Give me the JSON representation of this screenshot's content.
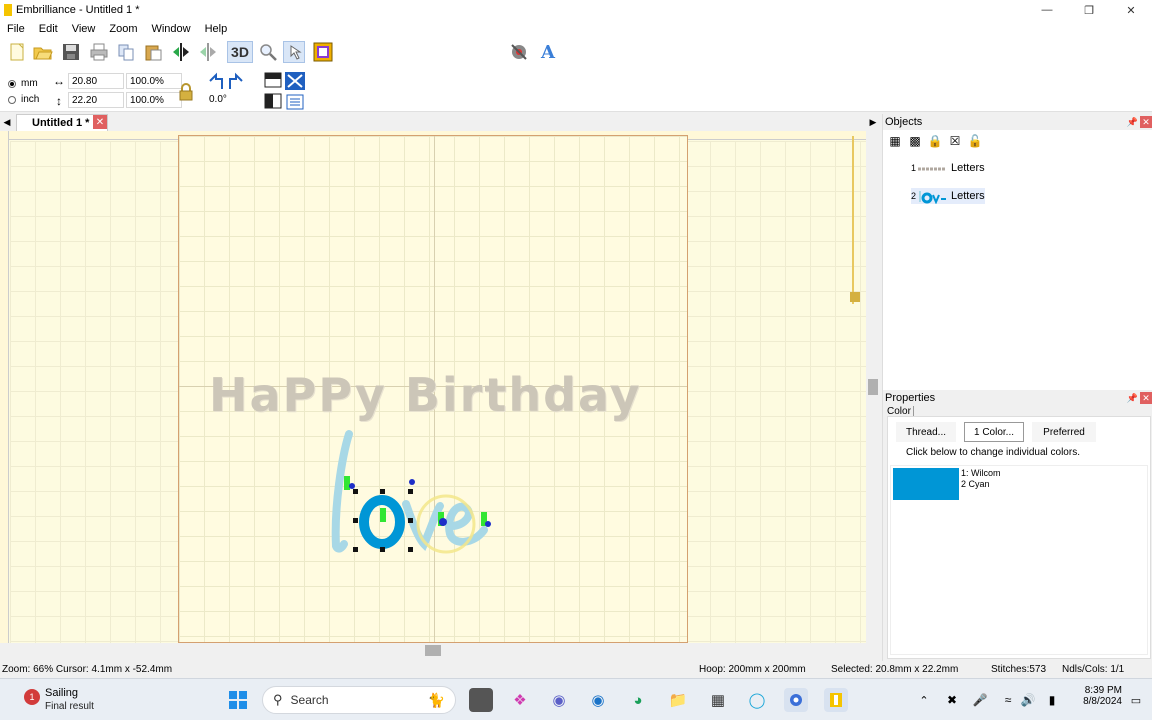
{
  "window": {
    "app_name": "Embrilliance",
    "title": "Embrilliance -  Untitled 1 *",
    "controls": [
      "minimize",
      "maximize",
      "close"
    ]
  },
  "menu": [
    "File",
    "Edit",
    "View",
    "Zoom",
    "Window",
    "Help"
  ],
  "toolbar": {
    "buttons": [
      "new-icon",
      "open-icon",
      "save-icon",
      "print-icon",
      "copy-icon",
      "paste-icon",
      "mirror-icon",
      "flip-icon",
      "3d-icon",
      "zoom-icon",
      "pointer-icon",
      "hoop-icon"
    ],
    "three_d_label": "3D",
    "right_buttons": [
      "thread-colors-icon",
      "lettering-icon"
    ],
    "lettering_label": "A"
  },
  "units": {
    "mm_label": "mm",
    "inch_label": "inch",
    "selected": "mm"
  },
  "dimensions": {
    "width_value": "20.80",
    "width_percent": "100.0%",
    "height_value": "22.20",
    "height_percent": "100.0%",
    "rotation": "0.0°"
  },
  "document_tab": {
    "label": "Untitled 1 *"
  },
  "canvas": {
    "text_object_1": "HaPPy Birthday",
    "text_object_2": "love",
    "colors": {
      "background": "#fdfbe0",
      "hoop_border": "#d4a070",
      "love_blue": "#0096d6",
      "love_light": "#a8d8e6"
    }
  },
  "objects_panel": {
    "title": "Objects",
    "items": [
      {
        "number": "1",
        "thumb": "HaPPy Birthday",
        "label": "Letters"
      },
      {
        "number": "2",
        "thumb": "love",
        "label": "Letters"
      }
    ]
  },
  "properties_panel": {
    "title": "Properties",
    "tab": "Color",
    "buttons": {
      "thread": "Thread...",
      "color": "1 Color...",
      "preferred": "Preferred"
    },
    "hint": "Click below to change individual colors.",
    "color_entries": [
      {
        "line1": "1: Wilcom",
        "line2": "2 Cyan",
        "swatch": "#0096d6"
      }
    ]
  },
  "status": {
    "zoom_cursor": "Zoom: 66%  Cursor: 4.1mm x -52.4mm",
    "hoop": "Hoop: 200mm x 200mm",
    "selected": "Selected: 20.8mm x 22.2mm",
    "stitches": "Stitches:573",
    "ndls": "Ndls/Cols: 1/1"
  },
  "taskbar": {
    "weather_badge": "1",
    "weather_title": "Sailing",
    "weather_sub": "Final result",
    "search_label": "Search",
    "time": "8:39 PM",
    "date": "8/8/2024"
  }
}
